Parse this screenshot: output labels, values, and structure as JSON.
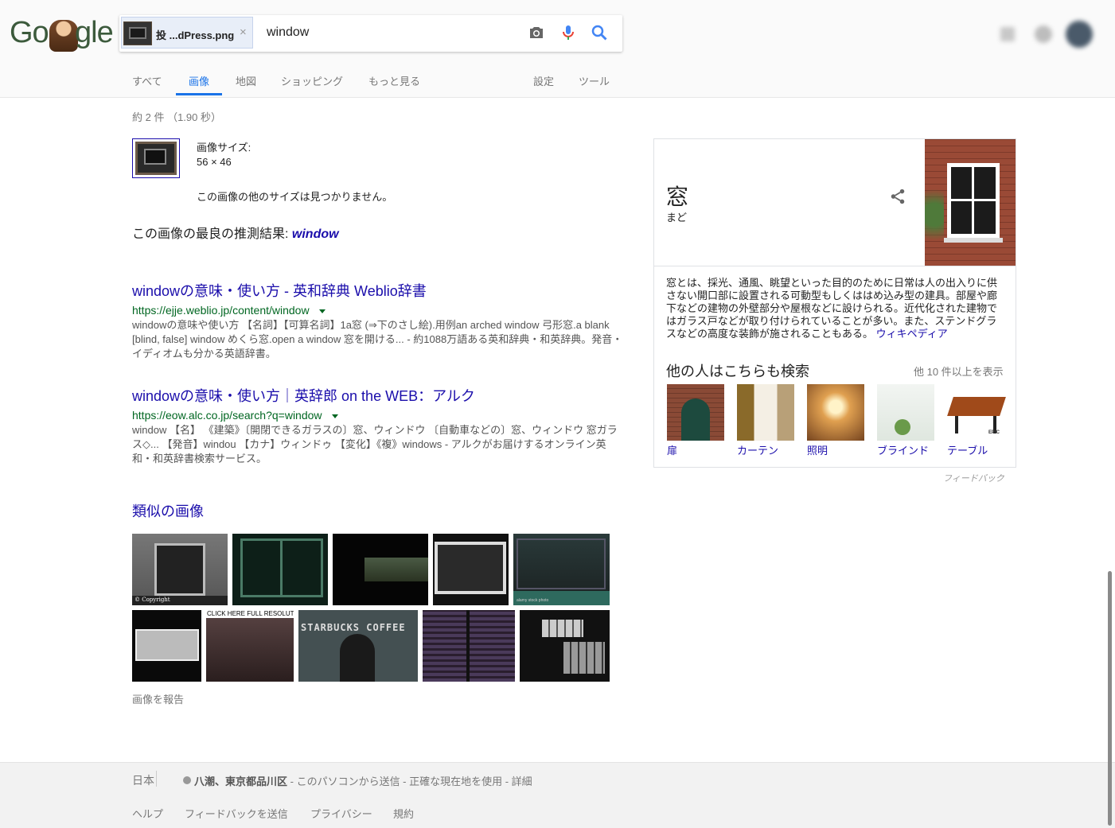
{
  "header": {
    "logo_left": "Go",
    "logo_right": "gle",
    "chip_filename": "投 ...dPress.png",
    "chip_close": "×",
    "query": "window",
    "tabs": [
      "すべて",
      "画像",
      "地図",
      "ショッピング",
      "もっと見る"
    ],
    "tools": [
      "設定",
      "ツール"
    ]
  },
  "results": {
    "stats": "約 2 件 （1.90 秒）",
    "image_size_label": "画像サイズ:",
    "image_size_value": "56 × 46",
    "no_other_sizes": "この画像の他のサイズは見つかりません。",
    "best_guess_prefix": "この画像の最良の推測結果: ",
    "best_guess": "window",
    "items": [
      {
        "title": "windowの意味・使い方 - 英和辞典 Weblio辞書",
        "url": "https://ejje.weblio.jp/content/window",
        "snippet": "windowの意味や使い方 【名詞】【可算名詞】1a窓 (⇒下のさし絵).用例an arched window 弓形窓.a blank [blind, false] window めくら窓.open a window 窓を開ける... - 約1088万語ある英和辞典・和英辞典。発音・イディオムも分かる英語辞書。"
      },
      {
        "title": "windowの意味・使い方｜英辞郎 on the WEB：アルク",
        "url": "https://eow.alc.co.jp/search?q=window",
        "snippet": "window 【名】 《建築》〔開閉できるガラスの〕窓、ウィンドウ 〔自動車などの〕窓、ウィンドウ 窓ガラス◇... 【発音】windou 【カナ】ウィンドゥ 【変化】《複》windows - アルクがお届けするオンライン英和・和英辞書検索サービス。"
      }
    ],
    "similar_title": "類似の画像",
    "similar_captions": [
      "© Copyright",
      "alamy stock photo",
      "CLICK HERE FULL RESOLUTI",
      "STARBUCKS COFFEE"
    ],
    "report": "画像を報告"
  },
  "knowledge_panel": {
    "title": "窓",
    "reading": "まど",
    "description": "窓とは、採光、通風、眺望といった目的のために日常は人の出入りに供さない開口部に設置される可動型もしくははめ込み型の建具。部屋や廊下などの建物の外壁部分や屋根などに設けられる。近代化された建物ではガラス戸などが取り付けられていることが多い。また、ステンドグラスなどの高度な装飾が施されることもある。",
    "source": "ウィキペディア",
    "also_search": "他の人はこちらも検索",
    "more": "他 10 件以上を表示",
    "items": [
      {
        "label": "扉"
      },
      {
        "label": "カーテン"
      },
      {
        "label": "照明"
      },
      {
        "label": "ブラインド"
      },
      {
        "label": "テーブル"
      }
    ],
    "epic_mark": "EPIC",
    "feedback": "フィードバック"
  },
  "footer": {
    "country": "日本",
    "location": "八潮、東京都品川区",
    "location_rest": " - このパソコンから送信 - 正確な現在地を使用 - 詳細",
    "links": [
      "ヘルプ",
      "フィードバックを送信",
      "プライバシー",
      "規約"
    ]
  }
}
